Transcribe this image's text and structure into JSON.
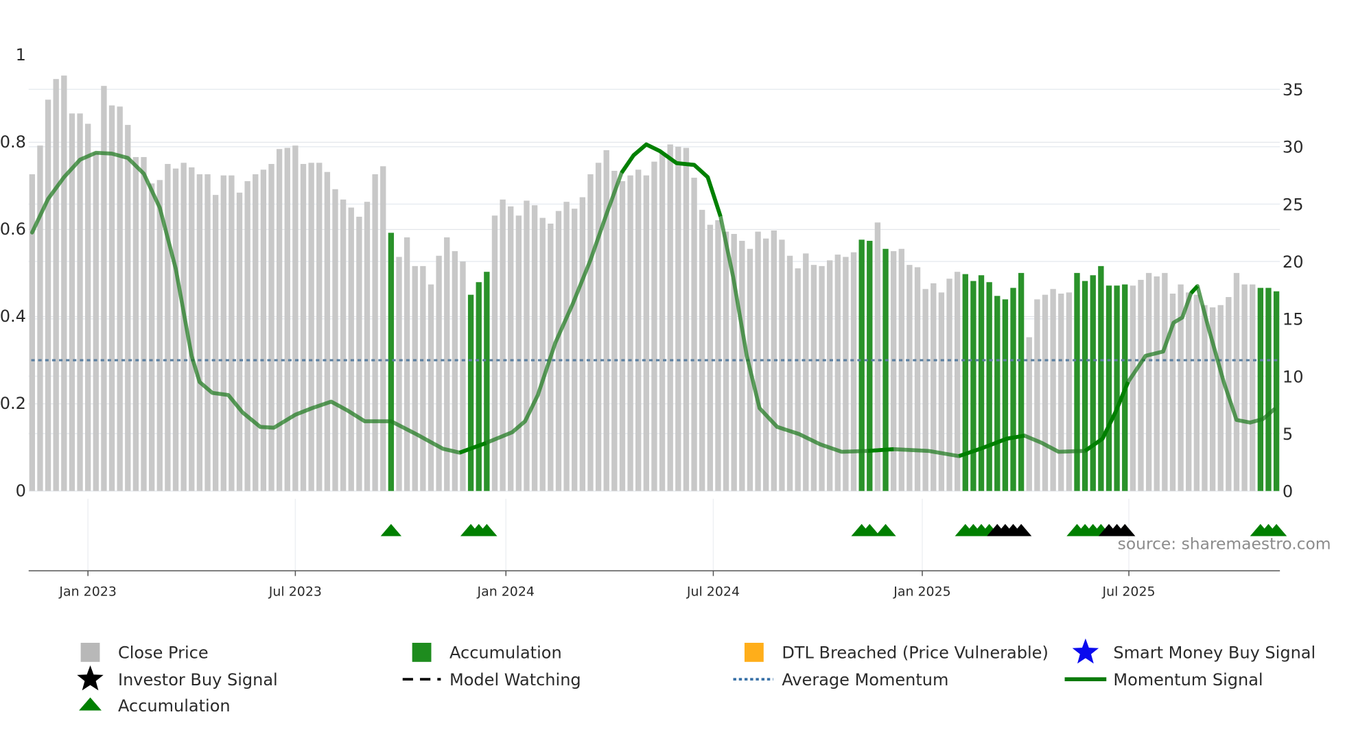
{
  "chart_data": {
    "type": "bar",
    "title": "",
    "xlabel": "",
    "ylabel_left": "",
    "ylabel_right": "",
    "left_axis": {
      "ylim": [
        0,
        1
      ],
      "ticks": [
        "0",
        "0.2",
        "0.4",
        "0.6",
        "0.8",
        "1"
      ],
      "tick_values": [
        0,
        0.2,
        0.4,
        0.6,
        0.8,
        1
      ]
    },
    "right_axis": {
      "ylim": [
        0,
        35
      ],
      "ticks": [
        "0",
        "5",
        "10",
        "15",
        "20",
        "25",
        "30",
        "35"
      ],
      "tick_values": [
        0,
        5,
        10,
        15,
        20,
        25,
        30,
        35
      ]
    },
    "x_ticks": [
      {
        "label": "Jan 2023",
        "index": 7
      },
      {
        "label": "Jul 2023",
        "index": 33
      },
      {
        "label": "Jan 2024",
        "index": 59.4
      },
      {
        "label": "Jul 2024",
        "index": 85.4
      },
      {
        "label": "Jan 2025",
        "index": 111.6
      },
      {
        "label": "Jul 2025",
        "index": 137.5
      }
    ],
    "grid": true,
    "close_price": [
      27.6,
      30.1,
      34.1,
      35.9,
      36.2,
      32.9,
      32.9,
      32.0,
      29.5,
      35.3,
      33.6,
      33.5,
      31.9,
      29.1,
      29.1,
      26.8,
      27.1,
      28.5,
      28.1,
      28.6,
      28.2,
      27.6,
      27.6,
      25.8,
      27.5,
      27.5,
      26.0,
      27.0,
      27.6,
      28.0,
      28.5,
      29.8,
      29.9,
      30.1,
      28.5,
      28.6,
      28.6,
      27.8,
      26.3,
      25.4,
      24.7,
      23.9,
      25.2,
      27.6,
      28.3,
      22.5,
      20.4,
      22.1,
      19.6,
      19.6,
      18.0,
      20.5,
      22.1,
      20.9,
      20.0,
      17.1,
      18.2,
      19.1,
      24.0,
      25.4,
      24.8,
      24.0,
      25.3,
      24.9,
      23.8,
      23.3,
      24.4,
      25.2,
      24.6,
      25.6,
      27.6,
      28.6,
      29.7,
      27.9,
      27.0,
      27.5,
      28.0,
      27.5,
      28.7,
      29.4,
      30.2,
      30.0,
      29.9,
      27.3,
      24.5,
      23.2,
      23.6,
      22.6,
      22.4,
      21.8,
      21.1,
      22.6,
      22.0,
      22.7,
      21.9,
      20.5,
      19.4,
      20.7,
      19.7,
      19.6,
      20.1,
      20.6,
      20.4,
      20.8,
      21.9,
      21.8,
      23.4,
      21.1,
      20.9,
      21.1,
      19.7,
      19.5,
      17.6,
      18.1,
      17.3,
      18.5,
      19.1,
      18.9,
      18.3,
      18.8,
      18.2,
      17.0,
      16.7,
      17.7,
      19.0,
      13.4,
      16.7,
      17.1,
      17.6,
      17.2,
      17.3,
      19.0,
      18.3,
      18.8,
      19.6,
      17.9,
      17.9,
      18.0,
      17.9,
      18.4,
      19.0,
      18.7,
      19.0,
      17.2,
      18.0,
      17.3,
      17.1,
      16.2,
      16.0,
      16.2,
      16.9,
      19.0,
      18.0,
      18.0,
      17.7,
      17.7,
      17.4
    ],
    "accumulation_bars": [
      45,
      55,
      56,
      57,
      104,
      105,
      107,
      117,
      118,
      119,
      120,
      121,
      122,
      123,
      124,
      131,
      132,
      133,
      134,
      135,
      136,
      137,
      154,
      155,
      156
    ],
    "accumulation_markers": [
      45,
      55,
      56,
      57,
      104,
      105,
      107,
      117,
      118,
      119,
      120,
      131,
      132,
      133,
      134,
      154,
      155,
      156
    ],
    "investor_buy_markers": [
      121,
      122,
      123,
      124,
      135,
      136,
      137
    ],
    "average_momentum": 0.3,
    "momentum_signal": [
      [
        0,
        0.593
      ],
      [
        2,
        0.67
      ],
      [
        4,
        0.72
      ],
      [
        6,
        0.76
      ],
      [
        8,
        0.776
      ],
      [
        10,
        0.774
      ],
      [
        12,
        0.764
      ],
      [
        14,
        0.728
      ],
      [
        16,
        0.65
      ],
      [
        18,
        0.51
      ],
      [
        20,
        0.31
      ],
      [
        21,
        0.25
      ],
      [
        22.6,
        0.225
      ],
      [
        24.6,
        0.22
      ],
      [
        26.4,
        0.18
      ],
      [
        28.6,
        0.147
      ],
      [
        30.3,
        0.145
      ],
      [
        33,
        0.175
      ],
      [
        35.1,
        0.19
      ],
      [
        37.5,
        0.205
      ],
      [
        39.5,
        0.185
      ],
      [
        41.7,
        0.16
      ],
      [
        45,
        0.16
      ],
      [
        48.2,
        0.13
      ],
      [
        51.5,
        0.097
      ],
      [
        53.6,
        0.088
      ],
      [
        56.9,
        0.11
      ],
      [
        60.2,
        0.135
      ],
      [
        61.8,
        0.16
      ],
      [
        63.4,
        0.22
      ],
      [
        65.6,
        0.34
      ],
      [
        67.8,
        0.43
      ],
      [
        70,
        0.53
      ],
      [
        72.1,
        0.64
      ],
      [
        73.9,
        0.73
      ],
      [
        75.4,
        0.77
      ],
      [
        77,
        0.795
      ],
      [
        78.7,
        0.78
      ],
      [
        80.8,
        0.752
      ],
      [
        83,
        0.748
      ],
      [
        84.7,
        0.72
      ],
      [
        86.3,
        0.63
      ],
      [
        87.9,
        0.49
      ],
      [
        89.6,
        0.31
      ],
      [
        91.2,
        0.19
      ],
      [
        93.4,
        0.147
      ],
      [
        96.1,
        0.131
      ],
      [
        98.8,
        0.107
      ],
      [
        101.5,
        0.09
      ],
      [
        104.8,
        0.092
      ],
      [
        108,
        0.096
      ],
      [
        112.4,
        0.092
      ],
      [
        116.2,
        0.08
      ],
      [
        118.9,
        0.097
      ],
      [
        122.2,
        0.12
      ],
      [
        124.4,
        0.127
      ],
      [
        126.5,
        0.111
      ],
      [
        128.7,
        0.09
      ],
      [
        132,
        0.092
      ],
      [
        134.2,
        0.12
      ],
      [
        135.8,
        0.18
      ],
      [
        137.4,
        0.25
      ],
      [
        139.6,
        0.31
      ],
      [
        141.8,
        0.32
      ],
      [
        143.1,
        0.386
      ],
      [
        144.2,
        0.398
      ],
      [
        145.3,
        0.454
      ],
      [
        146.1,
        0.47
      ],
      [
        147.4,
        0.38
      ],
      [
        149.4,
        0.25
      ],
      [
        151,
        0.163
      ],
      [
        152.7,
        0.157
      ],
      [
        154.3,
        0.165
      ],
      [
        155.7,
        0.187
      ]
    ],
    "momentum_strong_ranges": [
      [
        53,
        58
      ],
      [
        73.5,
        87.5
      ],
      [
        104,
        108
      ],
      [
        116,
        125
      ],
      [
        130,
        138
      ],
      [
        145,
        147
      ]
    ],
    "legend_position": "bottom",
    "legend": [
      {
        "label": "Close Price",
        "icon": "grey-square"
      },
      {
        "label": "Accumulation",
        "icon": "green-square"
      },
      {
        "label": "DTL Breached (Price Vulnerable)",
        "icon": "orange-square"
      },
      {
        "label": "Smart Money Buy Signal",
        "icon": "blue-star"
      },
      {
        "label": "Investor Buy Signal",
        "icon": "black-star"
      },
      {
        "label": "Model Watching",
        "icon": "black-dashed-line"
      },
      {
        "label": "Average Momentum",
        "icon": "blue-dotted-line"
      },
      {
        "label": "Momentum Signal",
        "icon": "green-line"
      },
      {
        "label": "Accumulation",
        "icon": "green-triangle"
      }
    ],
    "annotation": "source: sharemaestro.com"
  },
  "colors": {
    "close": "#c8c8c8",
    "accumulation": "#2a922a",
    "momentum": "#1f7a1f",
    "momentum_strong": "#008000",
    "avg": "#5a7fa0",
    "dtl": "#ffae1a",
    "smart": "#0a0aee",
    "investor": "#000000"
  }
}
